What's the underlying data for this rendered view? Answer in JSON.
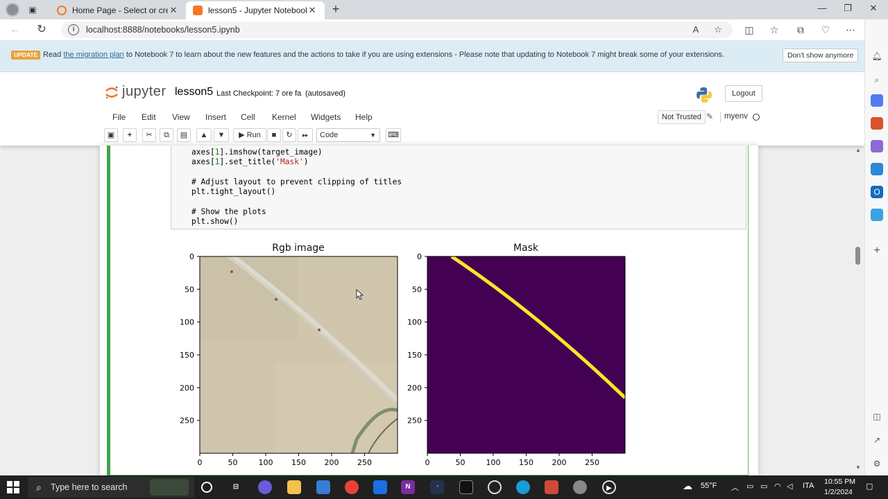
{
  "browser": {
    "tabs": [
      {
        "title": "Home Page - Select or create a n",
        "active": false
      },
      {
        "title": "lesson5 - Jupyter Notebook",
        "active": true
      }
    ],
    "url": "localhost:8888/notebooks/lesson5.ipynb"
  },
  "banner": {
    "badge": "UPDATE",
    "text_before": "Read ",
    "link": "the migration plan",
    "text_after": " to Notebook 7 to learn about the new features and the actions to take if you are using extensions - Please note that updating to Notebook 7 might break some of your extensions.",
    "dismiss_label": "Don't show anymore"
  },
  "jupyter": {
    "logo_text": "jupyter",
    "notebook_name": "lesson5",
    "checkpoint": "Last Checkpoint: 7 ore fa",
    "autosave": "(autosaved)",
    "logout_label": "Logout",
    "menu": [
      "File",
      "Edit",
      "View",
      "Insert",
      "Cell",
      "Kernel",
      "Widgets",
      "Help"
    ],
    "trusted_label": "Not Trusted",
    "kernel_name": "myenv",
    "run_label": "Run",
    "cell_type": "Code"
  },
  "code_lines": [
    {
      "pre": "axes[",
      "num": "1",
      "post": "].imshow(target_image)"
    },
    {
      "pre": "axes[",
      "num": "1",
      "post": "].set_title(",
      "str": "'Mask'",
      "end": ")"
    },
    {
      "comment": "# Adjust layout to prevent clipping of titles"
    },
    {
      "plain": "plt.tight_layout()"
    },
    {
      "comment": "# Show the plots"
    },
    {
      "plain": "plt.show()"
    }
  ],
  "chart_data": [
    {
      "type": "image",
      "title": "Rgb image",
      "xticks": [
        "0",
        "50",
        "100",
        "150",
        "200",
        "250"
      ],
      "yticks": [
        "0",
        "50",
        "100",
        "150",
        "200",
        "250"
      ],
      "xlim": [
        0,
        300
      ],
      "ylim": [
        300,
        0
      ]
    },
    {
      "type": "image",
      "title": "Mask",
      "xticks": [
        "0",
        "50",
        "100",
        "150",
        "200",
        "250"
      ],
      "yticks": [
        "0",
        "50",
        "100",
        "150",
        "200",
        "250"
      ],
      "xlim": [
        0,
        300
      ],
      "ylim": [
        300,
        0
      ],
      "colors": {
        "background": "#440154",
        "foreground": "#fde725"
      }
    }
  ],
  "taskbar": {
    "search_placeholder": "Type here to search",
    "weather": "55°F",
    "language": "ITA",
    "time": "10:55 PM",
    "date": "1/2/2024"
  }
}
